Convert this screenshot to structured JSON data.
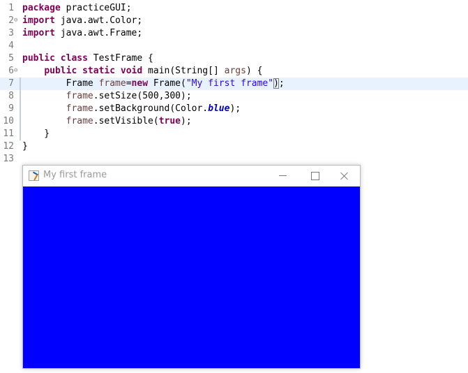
{
  "editor": {
    "lines": [
      {
        "num": "1",
        "fold": "",
        "tokens": [
          {
            "t": "package",
            "c": "kw"
          },
          {
            "t": " practiceGUI;",
            "c": ""
          }
        ]
      },
      {
        "num": "2",
        "fold": "⊖",
        "tokens": [
          {
            "t": "import",
            "c": "kw"
          },
          {
            "t": " java.awt.Color;",
            "c": ""
          }
        ]
      },
      {
        "num": "3",
        "fold": "",
        "tokens": [
          {
            "t": "import",
            "c": "kw"
          },
          {
            "t": " java.awt.Frame;",
            "c": ""
          }
        ]
      },
      {
        "num": "4",
        "fold": "",
        "tokens": []
      },
      {
        "num": "5",
        "fold": "",
        "tokens": [
          {
            "t": "public",
            "c": "kw"
          },
          {
            "t": " ",
            "c": ""
          },
          {
            "t": "class",
            "c": "kw"
          },
          {
            "t": " TestFrame {",
            "c": ""
          }
        ]
      },
      {
        "num": "6",
        "fold": "⊖",
        "tokens": [
          {
            "t": "    ",
            "c": ""
          },
          {
            "t": "public",
            "c": "kw"
          },
          {
            "t": " ",
            "c": ""
          },
          {
            "t": "static",
            "c": "kw"
          },
          {
            "t": " ",
            "c": ""
          },
          {
            "t": "void",
            "c": "kw"
          },
          {
            "t": " main(String[] ",
            "c": ""
          },
          {
            "t": "args",
            "c": "local"
          },
          {
            "t": ") {",
            "c": ""
          }
        ]
      },
      {
        "num": "7",
        "fold": "",
        "current": true,
        "tokens": [
          {
            "t": "        Frame ",
            "c": ""
          },
          {
            "t": "frame",
            "c": "local"
          },
          {
            "t": "=",
            "c": ""
          },
          {
            "t": "new",
            "c": "kw"
          },
          {
            "t": " Frame(",
            "c": ""
          },
          {
            "t": "\"My first frame\"",
            "c": "str"
          },
          {
            "t": ")",
            "c": "bracket"
          },
          {
            "t": ";",
            "c": ""
          }
        ]
      },
      {
        "num": "8",
        "fold": "",
        "tokens": [
          {
            "t": "        ",
            "c": ""
          },
          {
            "t": "frame",
            "c": "local"
          },
          {
            "t": ".setSize(500,300);",
            "c": ""
          }
        ]
      },
      {
        "num": "9",
        "fold": "",
        "tokens": [
          {
            "t": "        ",
            "c": ""
          },
          {
            "t": "frame",
            "c": "local"
          },
          {
            "t": ".setBackground(Color.",
            "c": ""
          },
          {
            "t": "blue",
            "c": "const"
          },
          {
            "t": ");",
            "c": ""
          }
        ]
      },
      {
        "num": "10",
        "fold": "",
        "tokens": [
          {
            "t": "        ",
            "c": ""
          },
          {
            "t": "frame",
            "c": "local"
          },
          {
            "t": ".setVisible(",
            "c": ""
          },
          {
            "t": "true",
            "c": "kw"
          },
          {
            "t": ");",
            "c": ""
          }
        ]
      },
      {
        "num": "11",
        "fold": "",
        "tokens": [
          {
            "t": "    }",
            "c": ""
          }
        ]
      },
      {
        "num": "12",
        "fold": "",
        "tokens": [
          {
            "t": "}",
            "c": ""
          }
        ]
      },
      {
        "num": "13",
        "fold": "",
        "tokens": []
      }
    ]
  },
  "frame_window": {
    "title": "My first frame",
    "icon": "java-icon",
    "background_color": "#0000ff"
  }
}
